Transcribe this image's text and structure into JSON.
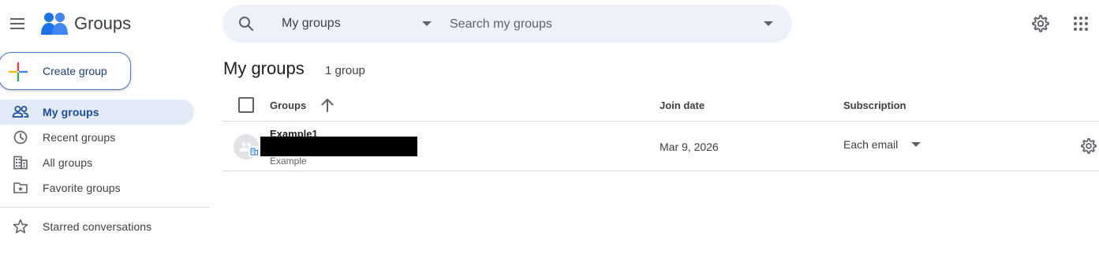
{
  "header": {
    "app_title": "Groups",
    "search": {
      "scope_selected": "My groups",
      "placeholder": "Search my groups"
    }
  },
  "actions": {
    "create_label": "Create group"
  },
  "sidebar": {
    "items": [
      {
        "label": "My groups",
        "icon": "people-icon",
        "active": true
      },
      {
        "label": "Recent groups",
        "icon": "clock-icon"
      },
      {
        "label": "All groups",
        "icon": "building-icon"
      },
      {
        "label": "Favorite groups",
        "icon": "star-folder-icon"
      },
      {
        "label": "Starred conversations",
        "icon": "star-icon"
      }
    ]
  },
  "main": {
    "title": "My groups",
    "count": "1 group",
    "columns": {
      "groups": "Groups",
      "join_date": "Join date",
      "subscription": "Subscription"
    },
    "rows": [
      {
        "name": "Example1",
        "description": "Example",
        "join_date": "Mar 9, 2026",
        "subscription": "Each email"
      }
    ]
  },
  "colors": {
    "accent_blue": "#1a4d9c",
    "active_bg": "#e4ebf8",
    "search_bg": "#edf2fa"
  }
}
